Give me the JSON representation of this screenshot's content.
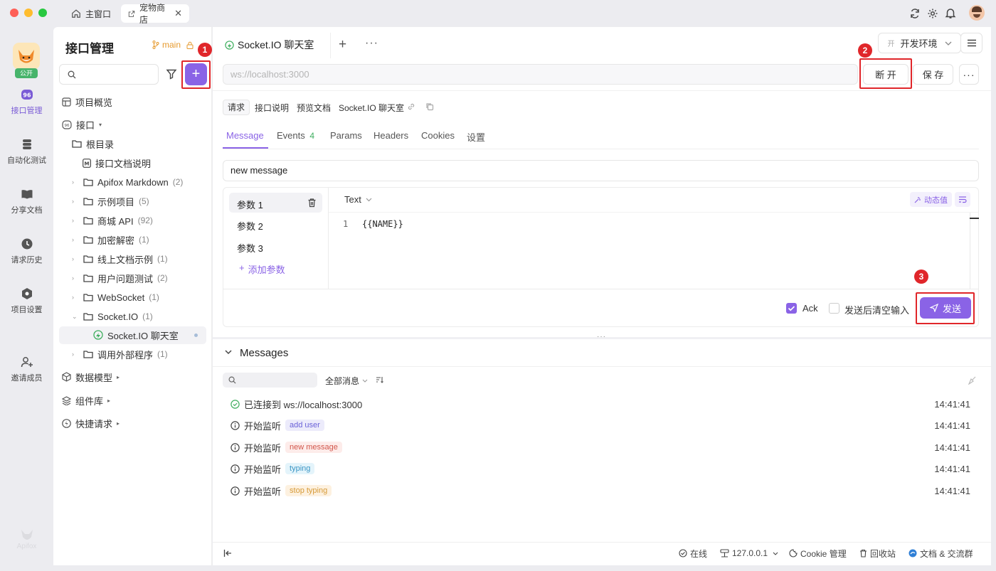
{
  "window": {
    "tabs": [
      {
        "label": "主窗口",
        "icon": "home-icon"
      },
      {
        "label": "宠物商店",
        "icon": "external-link-icon"
      }
    ]
  },
  "rail": {
    "logo_badge": "公开",
    "items": [
      {
        "label": "接口管理",
        "icon": "api-icon"
      },
      {
        "label": "自动化测试",
        "icon": "automation-icon"
      },
      {
        "label": "分享文档",
        "icon": "book-icon"
      },
      {
        "label": "请求历史",
        "icon": "clock-icon"
      },
      {
        "label": "项目设置",
        "icon": "settings-hex-icon"
      },
      {
        "label": "邀请成员",
        "icon": "add-user-icon"
      }
    ],
    "brand": "Apifox"
  },
  "sidebar": {
    "title": "接口管理",
    "branch": "main",
    "search_placeholder": "",
    "overview": "项目概览",
    "api_section": "接口",
    "root": "根目录",
    "doc_item": "接口文档说明",
    "folders": [
      {
        "label": "Apifox Markdown",
        "count": "(2)"
      },
      {
        "label": "示例项目",
        "count": "(5)"
      },
      {
        "label": "商城 API",
        "count": "(92)"
      },
      {
        "label": "加密解密",
        "count": "(1)"
      },
      {
        "label": "线上文档示例",
        "count": "(1)"
      },
      {
        "label": "用户问题测试",
        "count": "(2)"
      },
      {
        "label": "WebSocket",
        "count": "(1)"
      },
      {
        "label": "Socket.IO",
        "count": "(1)"
      }
    ],
    "selected_item": "Socket.IO 聊天室",
    "last_folder": {
      "label": "调用外部程序",
      "count": "(1)"
    },
    "sections": [
      "数据模型",
      "组件库",
      "快捷请求"
    ]
  },
  "header": {
    "tab_title": "Socket.IO 聊天室",
    "env_prefix": "开",
    "env_label": "开发环境",
    "url_placeholder": "ws://localhost:3000",
    "disconnect_label": "断 开",
    "save_label": "保 存"
  },
  "doc_tabs": [
    "请求",
    "接口说明",
    "预览文档"
  ],
  "doc_title": "Socket.IO 聊天室",
  "sub_tabs": [
    {
      "label": "Message",
      "count": ""
    },
    {
      "label": "Events",
      "count": "4"
    },
    {
      "label": "Params",
      "count": ""
    },
    {
      "label": "Headers",
      "count": ""
    },
    {
      "label": "Cookies",
      "count": ""
    },
    {
      "label": "设置",
      "count": ""
    }
  ],
  "event_name": "new message",
  "params": [
    "参数 1",
    "参数 2",
    "参数 3"
  ],
  "add_param": "添加参数",
  "editor": {
    "format": "Text",
    "dynamic_value": "动态值",
    "line_no": "1",
    "code": "{{NAME}}"
  },
  "send_bar": {
    "ack_label": "Ack",
    "ack_checked": true,
    "clear_label": "发送后清空输入",
    "clear_checked": false,
    "send_label": "发送"
  },
  "annotations": [
    "1",
    "2",
    "3"
  ],
  "messages": {
    "title": "Messages",
    "filter_label": "全部消息",
    "rows": [
      {
        "text": "已连接到 ws://localhost:3000",
        "tag": "",
        "time": "14:41:41",
        "icon": "check-circle-icon",
        "tag_bg": "",
        "tag_color": ""
      },
      {
        "text": "开始监听",
        "tag": "add user",
        "time": "14:41:41",
        "icon": "info-circle-icon",
        "tag_bg": "#ecebfb",
        "tag_color": "#6b62d8"
      },
      {
        "text": "开始监听",
        "tag": "new message",
        "time": "14:41:41",
        "icon": "info-circle-icon",
        "tag_bg": "#fdecea",
        "tag_color": "#d2564b"
      },
      {
        "text": "开始监听",
        "tag": "typing",
        "time": "14:41:41",
        "icon": "info-circle-icon",
        "tag_bg": "#e4f4fb",
        "tag_color": "#3a95c4"
      },
      {
        "text": "开始监听",
        "tag": "stop typing",
        "time": "14:41:41",
        "icon": "info-circle-icon",
        "tag_bg": "#fdf1e0",
        "tag_color": "#d69a38"
      }
    ]
  },
  "statusbar": {
    "online": "在线",
    "ip": "127.0.0.1",
    "cookie": "Cookie 管理",
    "recycle": "回收站",
    "docs": "文档 & 交流群"
  },
  "colors": {
    "accent": "#8a63e6",
    "annotation_red": "#e0262a",
    "success": "#3fae5f"
  }
}
